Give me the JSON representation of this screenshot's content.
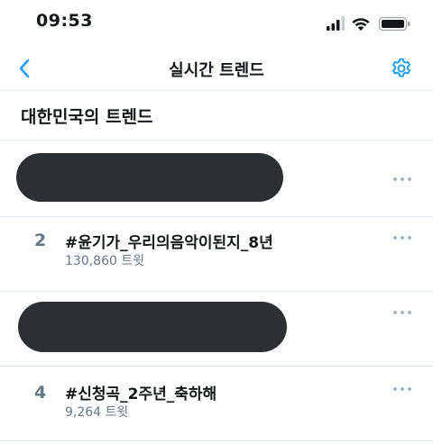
{
  "status_bar": {
    "time": "09:53",
    "icons": [
      "cellular-signal-icon",
      "wifi-icon",
      "battery-icon"
    ]
  },
  "nav": {
    "back_icon": "chevron-left-icon",
    "title": "실시간 트렌드",
    "settings_icon": "gear-icon"
  },
  "section": {
    "title": "대한민국의 트렌드"
  },
  "trends": [
    {
      "rank": "",
      "name": "",
      "count": "",
      "redacted": true
    },
    {
      "rank": "2",
      "name": "#윤기가_우리의음악이된지_8년",
      "count": "130,860 트윗",
      "redacted": false
    },
    {
      "rank": "",
      "name": "",
      "count": "",
      "redacted": true
    },
    {
      "rank": "4",
      "name": "#신청곡_2주년_축하해",
      "count": "9,264 트윗",
      "redacted": false
    }
  ],
  "colors": {
    "accent": "#1da1f2",
    "secondary_text": "#657786",
    "divider": "#e1e8ed",
    "redaction": "#2d3033"
  }
}
